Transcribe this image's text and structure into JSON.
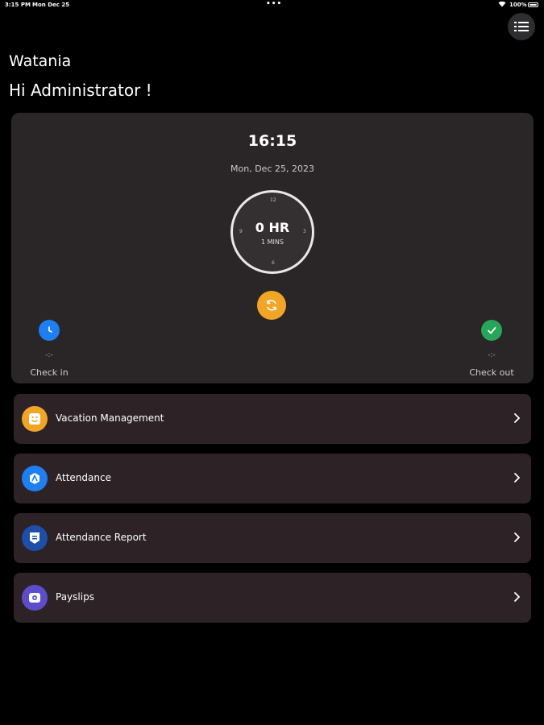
{
  "status_bar": {
    "time": "3:15 PM",
    "date": "Mon Dec 25",
    "dots": "•••",
    "battery": "100%"
  },
  "app": {
    "title": "Watania",
    "greeting": "Hi Administrator !"
  },
  "clock": {
    "time": "16:15",
    "date": "Mon, Dec 25, 2023",
    "hours": "0 HR",
    "minutes": "1 MINS",
    "dial_marks": {
      "top": "12",
      "right": "3",
      "bottom": "6",
      "left": "9"
    }
  },
  "check_in": {
    "value": "-:-",
    "label": "Check in"
  },
  "check_out": {
    "value": "-:-",
    "label": "Check out"
  },
  "menu": {
    "items": [
      {
        "label": "Vacation Management",
        "icon": "smile-face-icon",
        "color": "#f0a526"
      },
      {
        "label": "Attendance",
        "icon": "attendance-icon",
        "color": "#1f7ef0"
      },
      {
        "label": "Attendance Report",
        "icon": "report-badge-icon",
        "color": "#1e4fa8"
      },
      {
        "label": "Payslips",
        "icon": "payslip-icon",
        "color": "#5c4ec9"
      }
    ]
  },
  "colors": {
    "background": "#000000",
    "card": "#2a2627",
    "accent_orange": "#f0a526",
    "check_in_blue": "#1f7ef0",
    "check_out_green": "#27a55a"
  }
}
